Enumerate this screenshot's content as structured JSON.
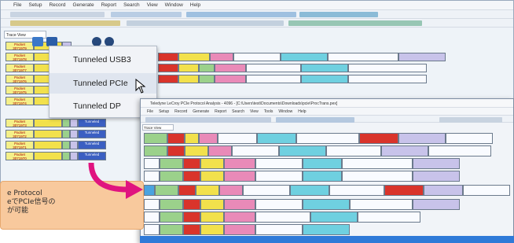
{
  "back_window": {
    "menu": [
      "File",
      "Setup",
      "Record",
      "Generate",
      "Report",
      "Search",
      "View",
      "Window",
      "Help"
    ],
    "tab_title": "Trace View",
    "rows_left": [
      {
        "packet": "Packet",
        "id": "3071979"
      },
      {
        "packet": "Packet",
        "id": "3071978"
      },
      {
        "packet": "Packet",
        "id": "3071977"
      },
      {
        "packet": "Packet",
        "id": "3071976"
      },
      {
        "packet": "Packet",
        "id": "3071975"
      },
      {
        "packet": "Packet",
        "id": "3071974"
      },
      {
        "packet": "Packet",
        "id": "3071973"
      },
      {
        "packet": "Packet",
        "id": "3071972"
      },
      {
        "packet": "Packet",
        "id": "3071971"
      },
      {
        "packet": "Packet",
        "id": "3071970"
      }
    ],
    "tunneled_label": "Tunneled"
  },
  "dropdown": {
    "items": [
      "Tunneled USB3",
      "Tunneled PCIe",
      "Tunneled DP"
    ],
    "selected_index": 1
  },
  "front_window": {
    "title": "Teledyne LeCroy PCIe Protocol Analysis - 4096 - [C:\\Users\\test\\Documents\\Downloads\\pcie\\ProcTrans.pex]",
    "menu": [
      "File",
      "Setup",
      "Record",
      "Generate",
      "Report",
      "Search",
      "View",
      "Tools",
      "Window",
      "Help"
    ],
    "tab_title": "Trace View"
  },
  "callout": {
    "line1": "e Protocol",
    "line2": "eでPCIe信号の",
    "line3": "が可能"
  },
  "colors": {
    "arrow": "#e0147f",
    "front_status": "#2f7ad8",
    "callout_bg": "#f8c99d"
  }
}
